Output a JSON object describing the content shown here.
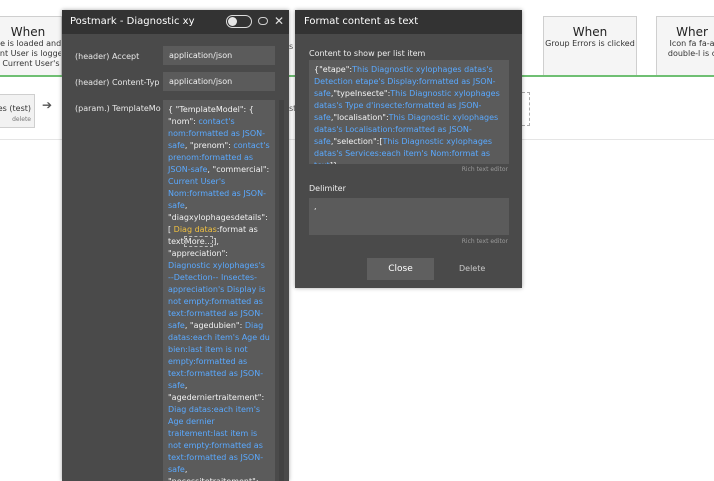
{
  "background": {
    "left_card": {
      "when": "When",
      "lines": [
        "ge is loaded and",
        "ent User is logge",
        "r Current User's"
      ]
    },
    "mid_card": {
      "when": "When",
      "lines": [
        "Group Errors is clicked"
      ]
    },
    "right_card": {
      "when": "Wher",
      "lines": [
        "Icon fa fa-a",
        "double-l is c"
      ]
    },
    "action": {
      "title": "ges (test)",
      "delete": "delete"
    },
    "cut_texts": [
      "s",
      "st"
    ]
  },
  "postmark": {
    "title": "Postmark - Diagnostic xy",
    "fields": [
      {
        "label": "(header) Accept",
        "value": "application/json"
      },
      {
        "label": "(header) Content-Typ",
        "value": "application/json"
      },
      {
        "label": "(param.) TemplateMo",
        "value": ""
      }
    ],
    "template": [
      {
        "t": "{ \"TemplateModel\": {  \"nom\": ",
        "c": ""
      },
      {
        "t": "contact's nom:formatted as JSON-safe",
        "c": "dyn"
      },
      {
        "t": ",         \"prenom\": ",
        "c": ""
      },
      {
        "t": "contact's prenom:formatted as JSON-safe",
        "c": "dyn"
      },
      {
        "t": ",        \"commercial\": ",
        "c": ""
      },
      {
        "t": "Current User's Nom:formatted as JSON-safe",
        "c": "dyn"
      },
      {
        "t": ",        \"diagxylophagesdetails\":[ ",
        "c": ""
      },
      {
        "t": "Diag datas",
        "c": "dyn-y"
      },
      {
        "t": ":format as text",
        "c": ""
      },
      {
        "t": "More...",
        "c": "sel"
      },
      {
        "t": "],        \"appreciation\": ",
        "c": ""
      },
      {
        "t": "Diagnostic xylophages's --Detection-- Insectes-appreciation's Display is not empty:formatted as text:formatted as JSON-safe",
        "c": "dyn"
      },
      {
        "t": ",        \"agedubien\": ",
        "c": ""
      },
      {
        "t": "Diag datas:each item's Age du bien:last item is not empty:formatted as text:formatted as JSON-safe",
        "c": "dyn"
      },
      {
        "t": ",        \"agederniertraitement\": ",
        "c": ""
      },
      {
        "t": "Diag datas:each item's Age dernier traitement:last item is not empty:formatted as text:formatted as JSON-safe",
        "c": "dyn"
      },
      {
        "t": ",        \"necessitetraitement\": ",
        "c": ""
      },
      {
        "t": "Diag",
        "c": "dyn"
      }
    ]
  },
  "format_panel": {
    "title": "Format content as text",
    "content_label": "Content to show per list item",
    "content": [
      {
        "t": "{\"etape\":",
        "c": ""
      },
      {
        "t": "This Diagnostic xylophages datas's Detection etape's Display:formatted as JSON-safe",
        "c": "dyn"
      },
      {
        "t": ",\"typeInsecte\":",
        "c": ""
      },
      {
        "t": "This Diagnostic xylophages datas's Type d'insecte:formatted as JSON-safe",
        "c": "dyn"
      },
      {
        "t": ",\"localisation\":",
        "c": ""
      },
      {
        "t": "This Diagnostic xylophages datas's Localisation:formatted as JSON-safe",
        "c": "dyn"
      },
      {
        "t": ",\"selection\":[",
        "c": ""
      },
      {
        "t": "This Diagnostic xylophages datas's Services:each item's Nom:format as text",
        "c": "dyn"
      },
      {
        "t": "]}",
        "c": ""
      }
    ],
    "rich_text_1": "Rich text editor",
    "delimiter_label": "Delimiter",
    "delimiter_value": ",",
    "rich_text_2": "Rich text editor",
    "close_label": "Close",
    "delete_label": "Delete"
  },
  "colors": {
    "panel_bg": "#4a4a4a",
    "header_bg": "#333333",
    "field_bg": "#5b5b5b",
    "dynamic_blue": "#5aa9ff",
    "dynamic_yellow": "#f0c040",
    "workflow_green": "#6fbf73"
  }
}
